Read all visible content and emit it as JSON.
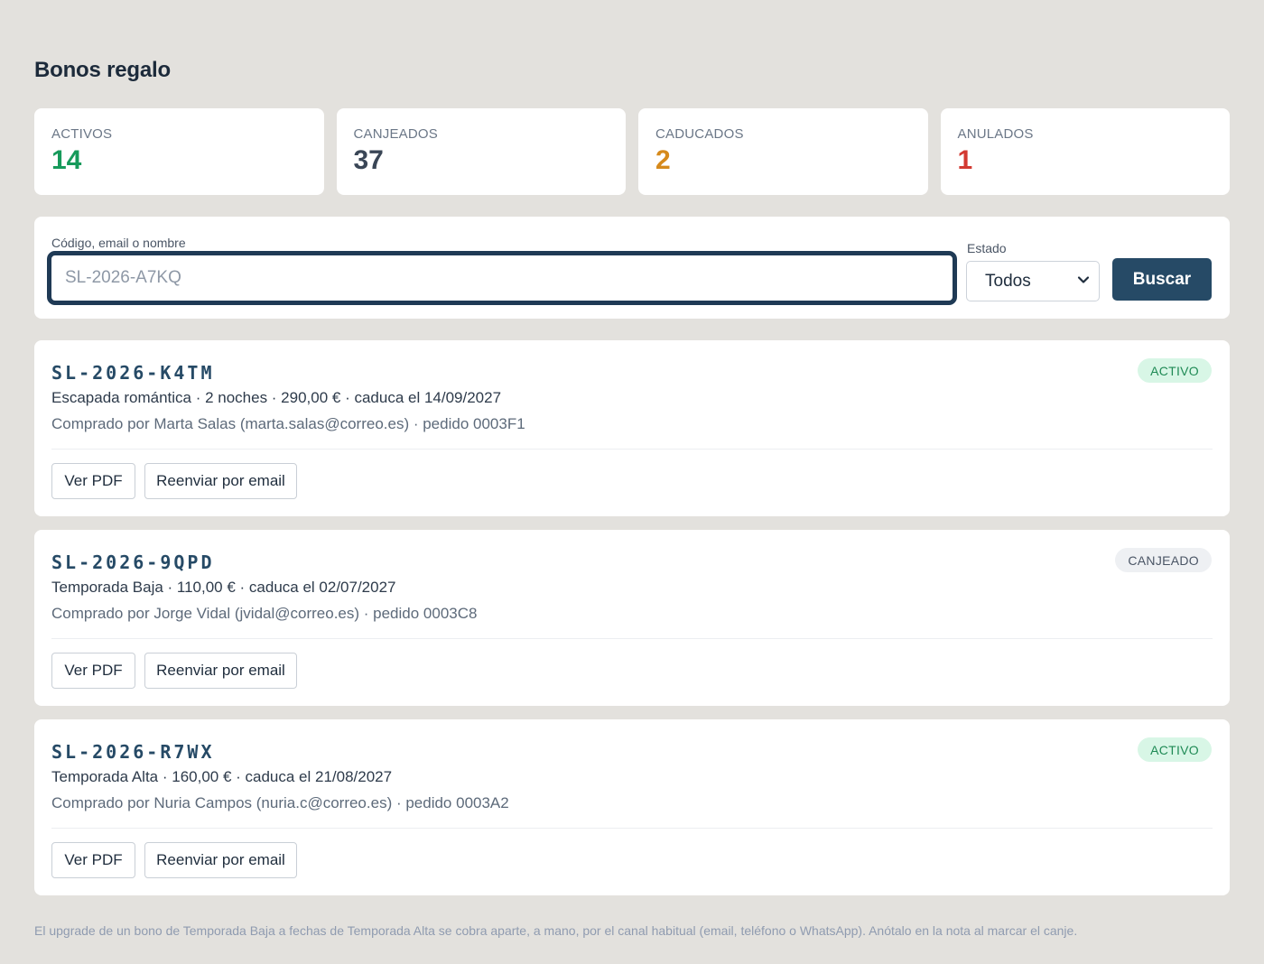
{
  "page": {
    "title": "Bonos regalo"
  },
  "stats": [
    {
      "label": "ACTIVOS",
      "value": "14",
      "color": "#179a5b"
    },
    {
      "label": "CANJEADOS",
      "value": "37",
      "color": "#3a4656"
    },
    {
      "label": "CADUCADOS",
      "value": "2",
      "color": "#d68a1c"
    },
    {
      "label": "ANULADOS",
      "value": "1",
      "color": "#d33a32"
    }
  ],
  "search": {
    "label": "Código, email o nombre",
    "placeholder": "SL-2026-A7KQ",
    "value": "",
    "estado_label": "Estado",
    "estado_value": "Todos",
    "button_label": "Buscar"
  },
  "vouchers": [
    {
      "code": "SL-2026-K4TM",
      "description": "Escapada romántica · 2 noches · 290,00 € · caduca el 14/09/2027",
      "buyer": "Comprado por Marta Salas (marta.salas@correo.es) · pedido 0003F1",
      "status": "ACTIVO",
      "status_bg": "#d8f6e6",
      "status_color": "#1f8a55",
      "pdf_label": "Ver PDF",
      "email_label": "Reenviar por email"
    },
    {
      "code": "SL-2026-9QPD",
      "description": "Temporada Baja · 110,00 € · caduca el 02/07/2027",
      "buyer": "Comprado por Jorge Vidal (jvidal@correo.es) · pedido 0003C8",
      "status": "CANJEADO",
      "status_bg": "#eef0f3",
      "status_color": "#4a5565",
      "pdf_label": "Ver PDF",
      "email_label": "Reenviar por email"
    },
    {
      "code": "SL-2026-R7WX",
      "description": "Temporada Alta · 160,00 € · caduca el 21/08/2027",
      "buyer": "Comprado por Nuria Campos (nuria.c@correo.es) · pedido 0003A2",
      "status": "ACTIVO",
      "status_bg": "#d8f6e6",
      "status_color": "#1f8a55",
      "pdf_label": "Ver PDF",
      "email_label": "Reenviar por email"
    }
  ],
  "footnote": "El upgrade de un bono de Temporada Baja a fechas de Temporada Alta se cobra aparte, a mano, por el canal habitual (email, teléfono o WhatsApp). Anótalo en la nota al marcar el canje.",
  "icons": {
    "select_chevron": "chevron-down-icon"
  }
}
